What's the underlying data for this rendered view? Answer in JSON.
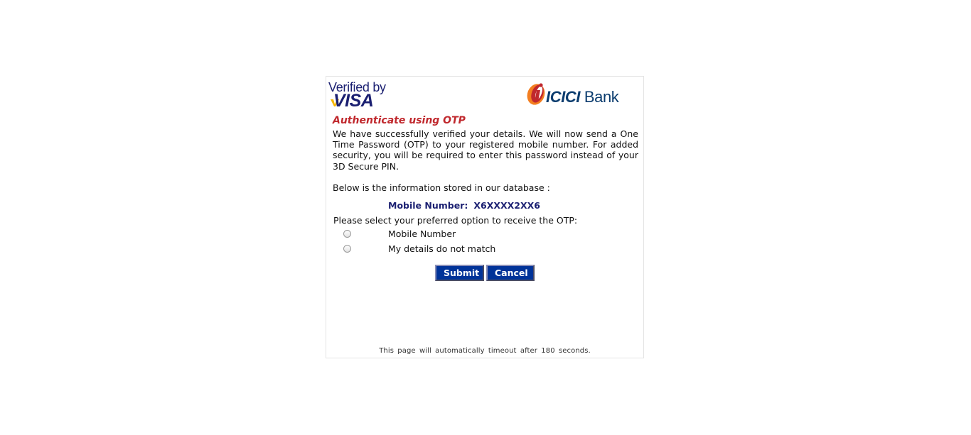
{
  "logos": {
    "visa_line1": "Verified by",
    "visa_line2": "VISA",
    "bank_name_bold": "ICICI",
    "bank_name_rest": "Bank"
  },
  "page": {
    "title": "Authenticate using OTP",
    "intro": "We have successfully verified your details. We will now send a One Time Password (OTP) to your registered mobile number. For added security, you will be required to enter this password instead of your 3D Secure PIN.",
    "below_info": "Below is the information stored in our database :",
    "mobile_label": "Mobile Number:",
    "mobile_value": "X6XXXX2XX6",
    "select_prompt": "Please select your preferred option to receive the OTP:",
    "options": [
      {
        "label": "Mobile Number",
        "selected": false
      },
      {
        "label": "My details do not match",
        "selected": false
      }
    ],
    "submit_label": "Submit",
    "cancel_label": "Cancel",
    "timeout_text": "This page will automatically timeout after 180 seconds."
  },
  "colors": {
    "title": "#c0282d",
    "visa_blue": "#1a1f71",
    "button_bg": "#003399",
    "icici_orange": "#f37e20",
    "icici_red": "#c0282d",
    "icici_text": "#0b3c6e"
  }
}
